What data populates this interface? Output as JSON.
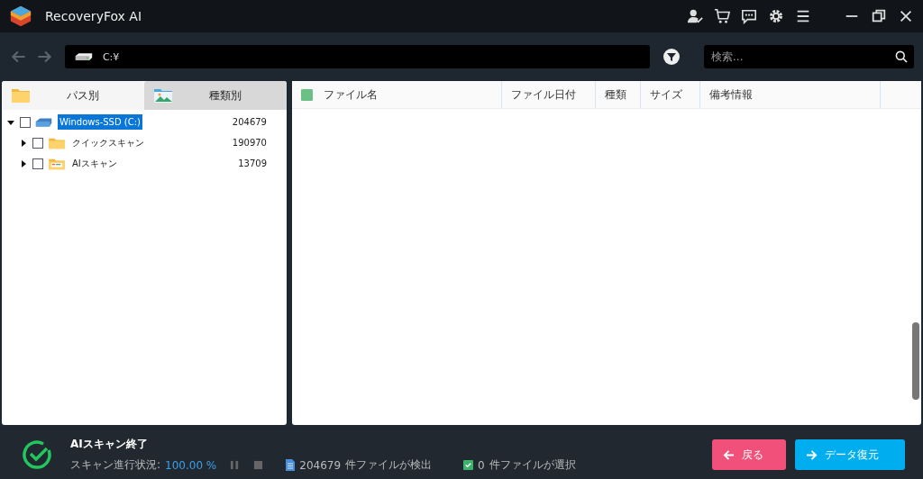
{
  "app": {
    "title": "RecoveryFox AI"
  },
  "path": {
    "value": "C:¥"
  },
  "search": {
    "placeholder": "検索..."
  },
  "tabs": [
    {
      "label": "パス別",
      "selected": true,
      "kind": "folder"
    },
    {
      "label": "種類別",
      "selected": false,
      "kind": "picture-folder"
    }
  ],
  "tree": [
    {
      "label": "Windows-SSD (C:)",
      "count": "204679",
      "kind": "drive",
      "expanded": true,
      "selected": true,
      "checked": false,
      "children": [
        {
          "label": "クイックスキャン",
          "count": "190970",
          "kind": "folder",
          "expanded": false,
          "selected": false,
          "checked": false
        },
        {
          "label": "AIスキャン",
          "count": "13709",
          "kind": "ai-folder",
          "expanded": false,
          "selected": false,
          "checked": false
        }
      ]
    }
  ],
  "table": {
    "select_all": {
      "checked": true
    },
    "columns": [
      "ファイル名",
      "ファイル日付",
      "種類",
      "サイズ",
      "備考情報"
    ]
  },
  "status": {
    "title": "AIスキャン終了",
    "progress_label": "スキャン進行状況:",
    "progress_value": "100.00 %",
    "found_count": "204679",
    "found_label": "件ファイルが検出",
    "selected_count": "0",
    "selected_label": "件ファイルが選択"
  },
  "buttons": [
    {
      "label": "戻る",
      "kind": "back"
    },
    {
      "label": "データ復元",
      "kind": "recover"
    }
  ]
}
